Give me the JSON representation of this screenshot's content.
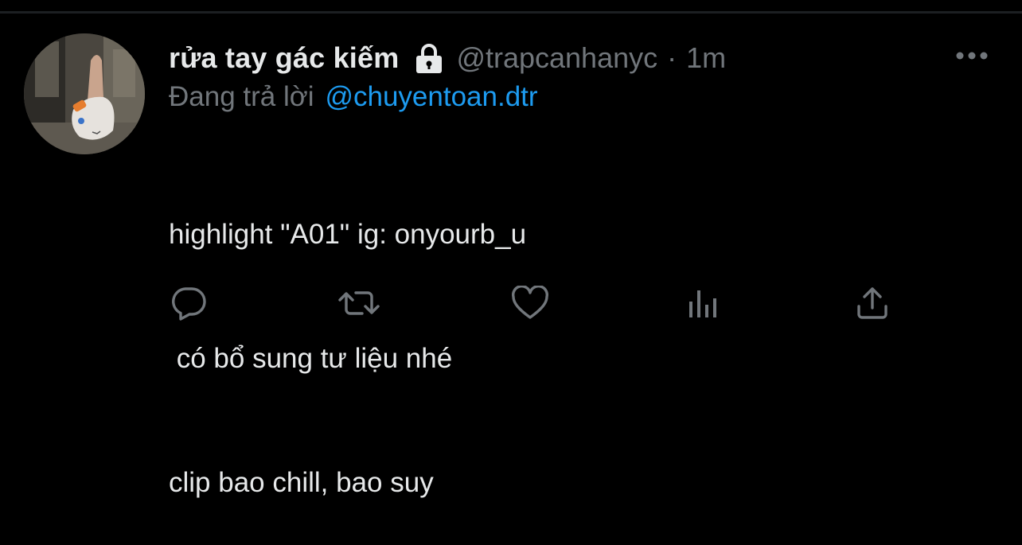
{
  "tweet": {
    "display_name": "rửa tay gác kiếm",
    "handle": "@trapcanhanyc",
    "separator": "·",
    "time": "1m",
    "reply_prefix": "Đang trả lời",
    "reply_to": "@chuyentoan.dtr",
    "body_lines": [
      "highlight \"A01\" ig: onyourb_u",
      " có bổ sung tư liệu nhé",
      "clip bao chill, bao suy"
    ]
  },
  "icons": {
    "lock": "lock-icon",
    "more": "more-dots-icon",
    "reply": "reply-bubble-icon",
    "retweet": "retweet-icon",
    "like": "heart-icon",
    "views": "analytics-bars-icon",
    "share": "share-upload-icon"
  },
  "colors": {
    "background": "#000000",
    "text_primary": "#e7e9ea",
    "text_secondary": "#71767b",
    "accent": "#1d9bf0"
  }
}
